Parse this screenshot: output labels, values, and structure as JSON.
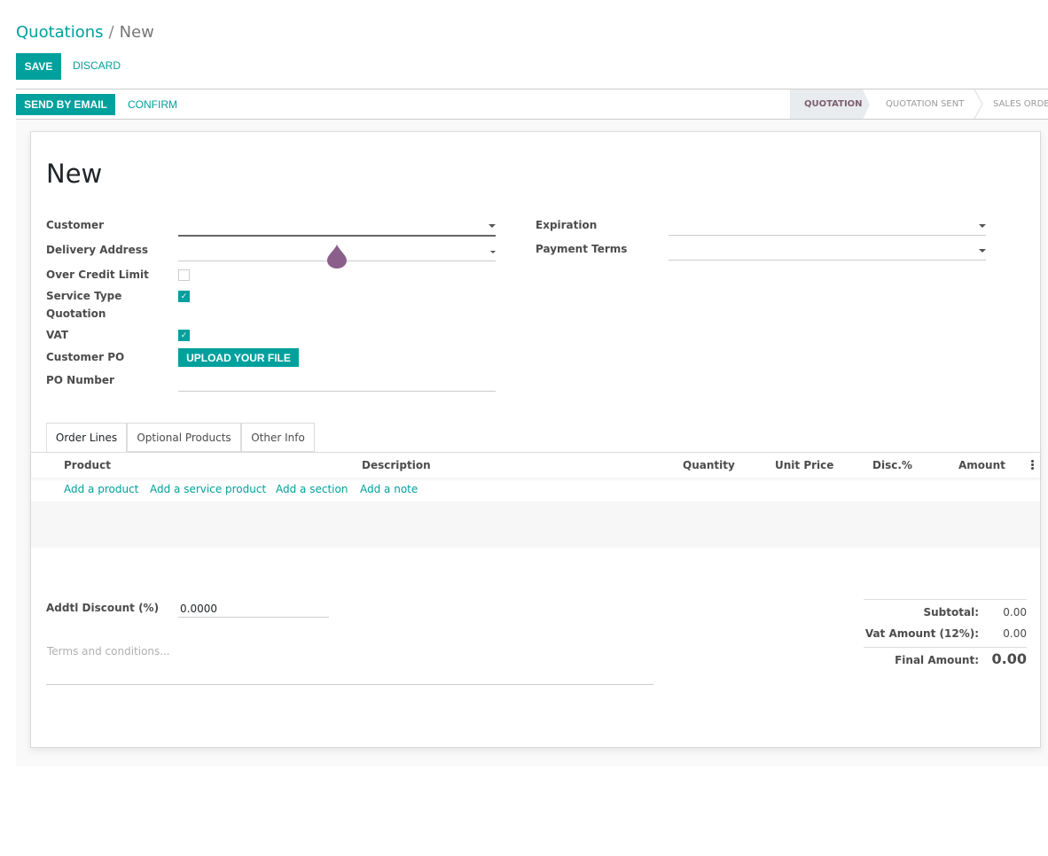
{
  "breadcrumb": {
    "parent": "Quotations",
    "separator": "/",
    "current": "New"
  },
  "actions": {
    "save": "SAVE",
    "discard": "DISCARD"
  },
  "statusbar": {
    "send_email": "SEND BY EMAIL",
    "confirm": "CONFIRM",
    "stages": [
      "QUOTATION",
      "QUOTATION SENT",
      "SALES ORDE"
    ]
  },
  "form": {
    "title": "New",
    "left_fields": {
      "customer": "Customer",
      "delivery_address": "Delivery Address",
      "over_credit_limit": "Over Credit Limit",
      "service_type_1": "Service Type",
      "service_type_2": "Quotation",
      "vat": "VAT",
      "customer_po": "Customer PO",
      "po_number": "PO Number"
    },
    "right_fields": {
      "expiration": "Expiration",
      "payment_terms": "Payment Terms"
    },
    "upload_label": "UPLOAD YOUR FILE",
    "checkboxes": {
      "over_credit_limit": false,
      "service_type_quotation": true,
      "vat": true
    }
  },
  "tabs": [
    "Order Lines",
    "Optional Products",
    "Other Info"
  ],
  "order_lines": {
    "columns": [
      "Product",
      "Description",
      "Quantity",
      "Unit Price",
      "Disc.%",
      "Amount"
    ],
    "add_links": [
      "Add a product",
      "Add a service product",
      "Add a section",
      "Add a note"
    ]
  },
  "footer": {
    "discount_label": "Addtl Discount (%)",
    "discount_value": "0.0000",
    "terms_placeholder": "Terms and conditions...",
    "subtotal_label": "Subtotal:",
    "subtotal_value": "0.00",
    "vat_label": "Vat Amount (12%):",
    "vat_value": "0.00",
    "final_label": "Final Amount:",
    "final_value": "0.00"
  },
  "colors": {
    "primary": "#00A09D",
    "active_stage": "#7c5e6f",
    "drop_marker": "#8a5f8a"
  }
}
